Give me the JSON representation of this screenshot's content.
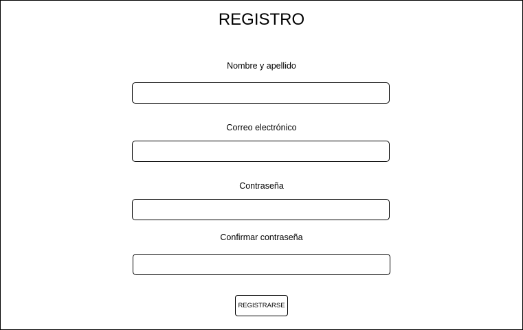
{
  "form": {
    "title": "REGISTRO",
    "fields": [
      {
        "label": "Nombre y apellido",
        "value": "",
        "placeholder": ""
      },
      {
        "label": "Correo electrónico",
        "value": "",
        "placeholder": ""
      },
      {
        "label": "Contraseña",
        "value": "",
        "placeholder": ""
      },
      {
        "label": "Confirmar contraseña",
        "value": "",
        "placeholder": ""
      }
    ],
    "submit_label": "REGISTRARSE"
  }
}
